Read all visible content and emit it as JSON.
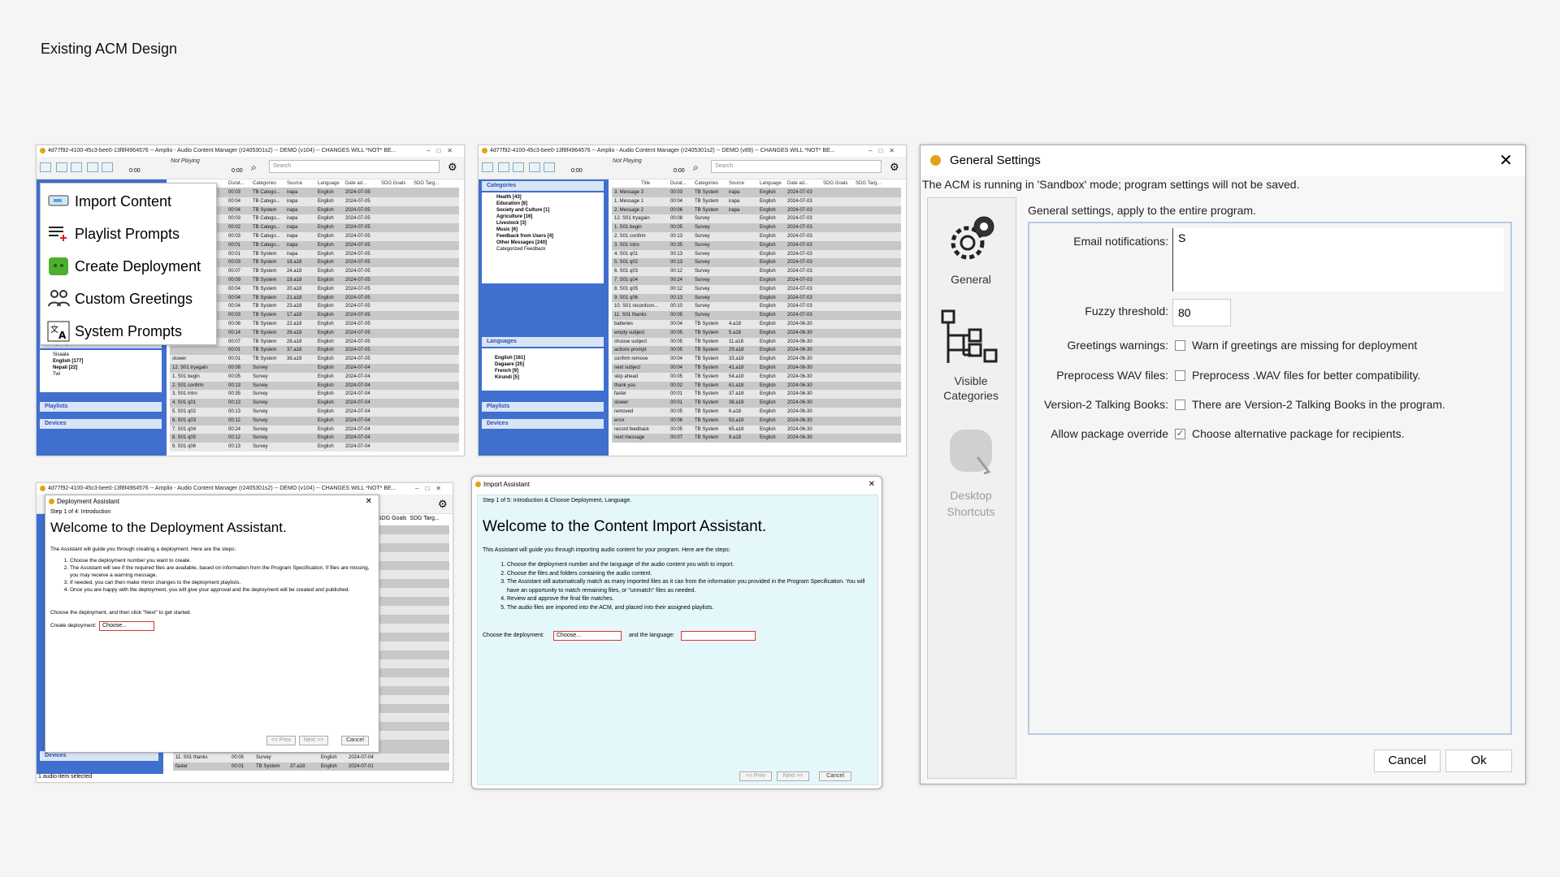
{
  "page_title": "Existing ACM Design",
  "acm_window": {
    "title_left": "4d77f92-4100-45c3-bee0-13f8f4964576 -- Amplio - Audio Content Manager (r2405301s2) -- DEMO (v104) -- CHANGES WILL *NOT* BE...",
    "title_right": "4d77f92-4100-45c3-bee0-13f8f4964576 -- Amplio - Audio Content Manager (r2405301s2) -- DEMO (v89) -- CHANGES WILL *NOT* BE...",
    "title_bottom": "4d77f92-4100-45c3-bee0-13f8f4964576 -- Amplio - Audio Content Manager (r2405301s2) -- DEMO (v104) -- CHANGES WILL *NOT* BE...",
    "not_playing": "Not Playing",
    "time_start": "0:00",
    "time_end": "0:00",
    "search_placeholder": "Search",
    "columns": [
      "Title",
      "Durat...",
      "Categories",
      "Source",
      "Language",
      "Date ad...",
      "SDG Goals",
      "SDG Targ..."
    ]
  },
  "tools_menu": [
    {
      "label": "Import Content",
      "icon": "import-icon"
    },
    {
      "label": "Playlist Prompts",
      "icon": "playlist-icon"
    },
    {
      "label": "Create Deployment",
      "icon": "deployment-icon"
    },
    {
      "label": "Custom Greetings",
      "icon": "greetings-icon"
    },
    {
      "label": "System Prompts",
      "icon": "system-prompts-icon"
    }
  ],
  "sidebar": {
    "categories_header": "Categories",
    "categories": [
      "Health [43]",
      "Education [8]",
      "Society and Culture [1]",
      "Agriculture [16]",
      "Livestock [3]",
      "Music [6]",
      "Feedback from Users [4]",
      "Other Messages [240]",
      "Categorized Feedback"
    ],
    "languages_header": "Languages",
    "languages_left": [
      "Sisaala",
      "English [177]",
      "Nepali [22]",
      "Twi"
    ],
    "languages_right": [
      "English [161]",
      "Dagaare [25]",
      "French [9]",
      "Kirundi [5]"
    ],
    "playlists_header": "Playlists",
    "devices_header": "Devices"
  },
  "left_rows": [
    [
      "",
      "00:03",
      "TB Catego...",
      "irapa",
      "English",
      "2024-07-05"
    ],
    [
      "",
      "00:04",
      "TB Catego...",
      "irapa",
      "English",
      "2024-07-05"
    ],
    [
      "",
      "00:04",
      "TB System",
      "irapa",
      "English",
      "2024-07-05"
    ],
    [
      "",
      "00:03",
      "TB Catego...",
      "irapa",
      "English",
      "2024-07-05"
    ],
    [
      "",
      "00:02",
      "TB Catego...",
      "irapa",
      "English",
      "2024-07-05"
    ],
    [
      "",
      "00:03",
      "TB Catego...",
      "irapa",
      "English",
      "2024-07-05"
    ],
    [
      "",
      "00:01",
      "TB Catego...",
      "irapa",
      "English",
      "2024-07-05"
    ],
    [
      "",
      "00:01",
      "TB System",
      "irapa",
      "English",
      "2024-07-05"
    ],
    [
      "",
      "00:03",
      "TB System",
      "16.a18",
      "English",
      "2024-07-05"
    ],
    [
      "",
      "00:07",
      "TB System",
      "24.a18",
      "English",
      "2024-07-05"
    ],
    [
      "",
      "00:09",
      "TB System",
      "19.a18",
      "English",
      "2024-07-05"
    ],
    [
      "",
      "00:04",
      "TB System",
      "20.a18",
      "English",
      "2024-07-05"
    ],
    [
      "",
      "00:04",
      "TB System",
      "21.a18",
      "English",
      "2024-07-05"
    ],
    [
      "",
      "00:04",
      "TB System",
      "23.a18",
      "English",
      "2024-07-05"
    ],
    [
      "",
      "00:03",
      "TB System",
      "17.a18",
      "English",
      "2024-07-05"
    ],
    [
      "",
      "00:06",
      "TB System",
      "22.a18",
      "English",
      "2024-07-05"
    ],
    [
      "",
      "00:14",
      "TB System",
      "26.a18",
      "English",
      "2024-07-05"
    ],
    [
      "",
      "00:07",
      "TB System",
      "28.a18",
      "English",
      "2024-07-05"
    ],
    [
      "",
      "00:01",
      "TB System",
      "37.a18",
      "English",
      "2024-07-05"
    ],
    [
      "slower",
      "00:01",
      "TB System",
      "38.a18",
      "English",
      "2024-07-05"
    ],
    [
      "12. S01 tryagain",
      "00:08",
      "Survey",
      "",
      "English",
      "2024-07-04"
    ],
    [
      "1. S01 begin",
      "00:05",
      "Survey",
      "",
      "English",
      "2024-07-04"
    ],
    [
      "2. S01 confirm",
      "00:13",
      "Survey",
      "",
      "English",
      "2024-07-04"
    ],
    [
      "3. S01 intro",
      "00:35",
      "Survey",
      "",
      "English",
      "2024-07-04"
    ],
    [
      "4. S01 q01",
      "00:13",
      "Survey",
      "",
      "English",
      "2024-07-04"
    ],
    [
      "5. S01 q02",
      "00:13",
      "Survey",
      "",
      "English",
      "2024-07-04"
    ],
    [
      "6. S01 q03",
      "00:12",
      "Survey",
      "",
      "English",
      "2024-07-04"
    ],
    [
      "7. S01 q04",
      "00:24",
      "Survey",
      "",
      "English",
      "2024-07-04"
    ],
    [
      "8. S01 q05",
      "00:12",
      "Survey",
      "",
      "English",
      "2024-07-04"
    ],
    [
      "9. S01 q06",
      "00:13",
      "Survey",
      "",
      "English",
      "2024-07-04"
    ]
  ],
  "right_rows": [
    [
      "3. Message 3",
      "00:03",
      "TB System",
      "irapa",
      "English",
      "2024-07-03"
    ],
    [
      "1. Message 1",
      "00:04",
      "TB System",
      "irapa",
      "English",
      "2024-07-03"
    ],
    [
      "2. Message 2",
      "00:06",
      "TB System",
      "irapa",
      "English",
      "2024-07-03"
    ],
    [
      "12. S01 tryagain",
      "00:08",
      "Survey",
      "",
      "English",
      "2024-07-03"
    ],
    [
      "1. S01 begin",
      "00:05",
      "Survey",
      "",
      "English",
      "2024-07-03"
    ],
    [
      "2. S01 confirm",
      "00:13",
      "Survey",
      "",
      "English",
      "2024-07-03"
    ],
    [
      "3. S01 intro",
      "00:35",
      "Survey",
      "",
      "English",
      "2024-07-03"
    ],
    [
      "4. S01 q01",
      "00:13",
      "Survey",
      "",
      "English",
      "2024-07-03"
    ],
    [
      "5. S01 q02",
      "00:13",
      "Survey",
      "",
      "English",
      "2024-07-03"
    ],
    [
      "6. S01 q03",
      "00:12",
      "Survey",
      "",
      "English",
      "2024-07-03"
    ],
    [
      "7. S01 q04",
      "00:24",
      "Survey",
      "",
      "English",
      "2024-07-03"
    ],
    [
      "8. S01 q05",
      "00:12",
      "Survey",
      "",
      "English",
      "2024-07-03"
    ],
    [
      "9. S01 q06",
      "00:13",
      "Survey",
      "",
      "English",
      "2024-07-03"
    ],
    [
      "10. S01 recordcon...",
      "00:10",
      "Survey",
      "",
      "English",
      "2024-07-03"
    ],
    [
      "11. S01 thanks",
      "00:05",
      "Survey",
      "",
      "English",
      "2024-07-03"
    ],
    [
      "batteries",
      "00:04",
      "TB System",
      "4.a18",
      "English",
      "2024-06-30"
    ],
    [
      "empty subject",
      "00:05",
      "TB System",
      "5.a18",
      "English",
      "2024-06-30"
    ],
    [
      "choose subject",
      "00:05",
      "TB System",
      "11.a18",
      "English",
      "2024-06-30"
    ],
    [
      "actions prompt",
      "00:05",
      "TB System",
      "29.a18",
      "English",
      "2024-06-30"
    ],
    [
      "confirm remove",
      "00:04",
      "TB System",
      "33.a18",
      "English",
      "2024-06-30"
    ],
    [
      "next subject",
      "00:04",
      "TB System",
      "41.a18",
      "English",
      "2024-06-30"
    ],
    [
      "skip ahead",
      "00:05",
      "TB System",
      "54.a18",
      "English",
      "2024-06-30"
    ],
    [
      "thank you",
      "00:02",
      "TB System",
      "61.a18",
      "English",
      "2024-06-30"
    ],
    [
      "faster",
      "00:01",
      "TB System",
      "37.a18",
      "English",
      "2024-06-30"
    ],
    [
      "slower",
      "00:01",
      "TB System",
      "38.a18",
      "English",
      "2024-06-30"
    ],
    [
      "removed",
      "00:05",
      "TB System",
      "6.a18",
      "English",
      "2024-06-30"
    ],
    [
      "error",
      "00:06",
      "TB System",
      "53.a18",
      "English",
      "2024-06-30"
    ],
    [
      "record feedback",
      "00:05",
      "TB System",
      "65.a18",
      "English",
      "2024-06-30"
    ],
    [
      "next message",
      "00:07",
      "TB System",
      "9.a18",
      "English",
      "2024-06-30"
    ]
  ],
  "deploy_rows": [
    [
      "10. S01 recordcon...",
      "00:10",
      "Survey",
      "",
      "English",
      "2024-07-04"
    ],
    [
      "11. S01 thanks",
      "00:05",
      "Survey",
      "",
      "English",
      "2024-07-04"
    ],
    [
      "faster",
      "00:01",
      "TB System",
      "37.a18",
      "English",
      "2024-07-01"
    ]
  ],
  "deployment_assistant": {
    "title": "Deployment Assistant",
    "step": "Step 1 of 4: Introduction",
    "heading": "Welcome to the Deployment Assistant.",
    "intro": "The Assistant will guide you through creating a deployment. Here are the steps:",
    "steps": [
      "Choose the deployment number you want to create.",
      "The Assistant will see if the required files are available, based on information from the Program Specification. If files are missing, you may receive a warning message.",
      "If needed, you can then make minor changes to the deployment playlists.",
      "Once you are happy with the deployment, you will give your approval and the deployment will be created and published."
    ],
    "instruction": "Choose the deployment, and then click \"Next\" to get started.",
    "create_label": "Create deployment:",
    "choose": "Choose...",
    "prev": "<< Prev",
    "next": "Next >>",
    "cancel": "Cancel",
    "status": "1 audio item selected",
    "devices": "Devices",
    "sdg_goals": "SDG Goals",
    "sdg_targ": "SDG Targ..."
  },
  "import_assistant": {
    "title": "Import Assistant",
    "step": "Step 1 of 5: Introduction & Choose Deployment, Language.",
    "heading": "Welcome to the Content Import Assistant.",
    "intro": "This Assistant will guide you through importing audio content for your program. Here are the steps:",
    "steps": [
      "Choose the deployment number and the language of the audio content you wish to import.",
      "Choose the files and folders containing the audio content.",
      "The Assistant will automatically match as many imported files as it can from the information you provided in the Program Specification. You will have an opportunity to match remaining files, or \"unmatch\" files as needed.",
      "Review and approve the final file matches.",
      "The audio files are imported into the ACM, and placed into their assigned playlists."
    ],
    "choose_label": "Choose the deployment:",
    "choose": "Choose...",
    "and_language": "and the language:",
    "prev": "<< Prev",
    "next": "Next >>",
    "cancel": "Cancel"
  },
  "general_settings": {
    "title": "General Settings",
    "sandbox_notice": "The ACM is running in 'Sandbox' mode; program settings will not be saved.",
    "nav": [
      {
        "label": "General",
        "icon": "gears-icon"
      },
      {
        "label": "Visible Categories",
        "icon": "tree-icon"
      },
      {
        "label": "Desktop Shortcuts",
        "icon": "shortcut-icon"
      }
    ],
    "heading": "General settings, apply to the entire program.",
    "email_label": "Email notifications:",
    "email_value": "S",
    "fuzzy_label": "Fuzzy threshold:",
    "fuzzy_value": "80",
    "greetings_label": "Greetings warnings:",
    "greetings_text": "Warn if greetings are missing for deployment",
    "preprocess_label": "Preprocess WAV files:",
    "preprocess_text": "Preprocess .WAV files for better compatibility.",
    "v2_label": "Version-2 Talking Books:",
    "v2_text": "There are Version-2 Talking Books in the program.",
    "override_label": "Allow package override",
    "override_text": "Choose alternative package for recipients.",
    "cancel": "Cancel",
    "ok": "Ok"
  },
  "colors": {
    "sidebar_blue": "#3f6fcf",
    "cyan_bg": "#e4f7fb",
    "row_dark": "#c8c8c8",
    "row_light": "#e7e7e7"
  }
}
